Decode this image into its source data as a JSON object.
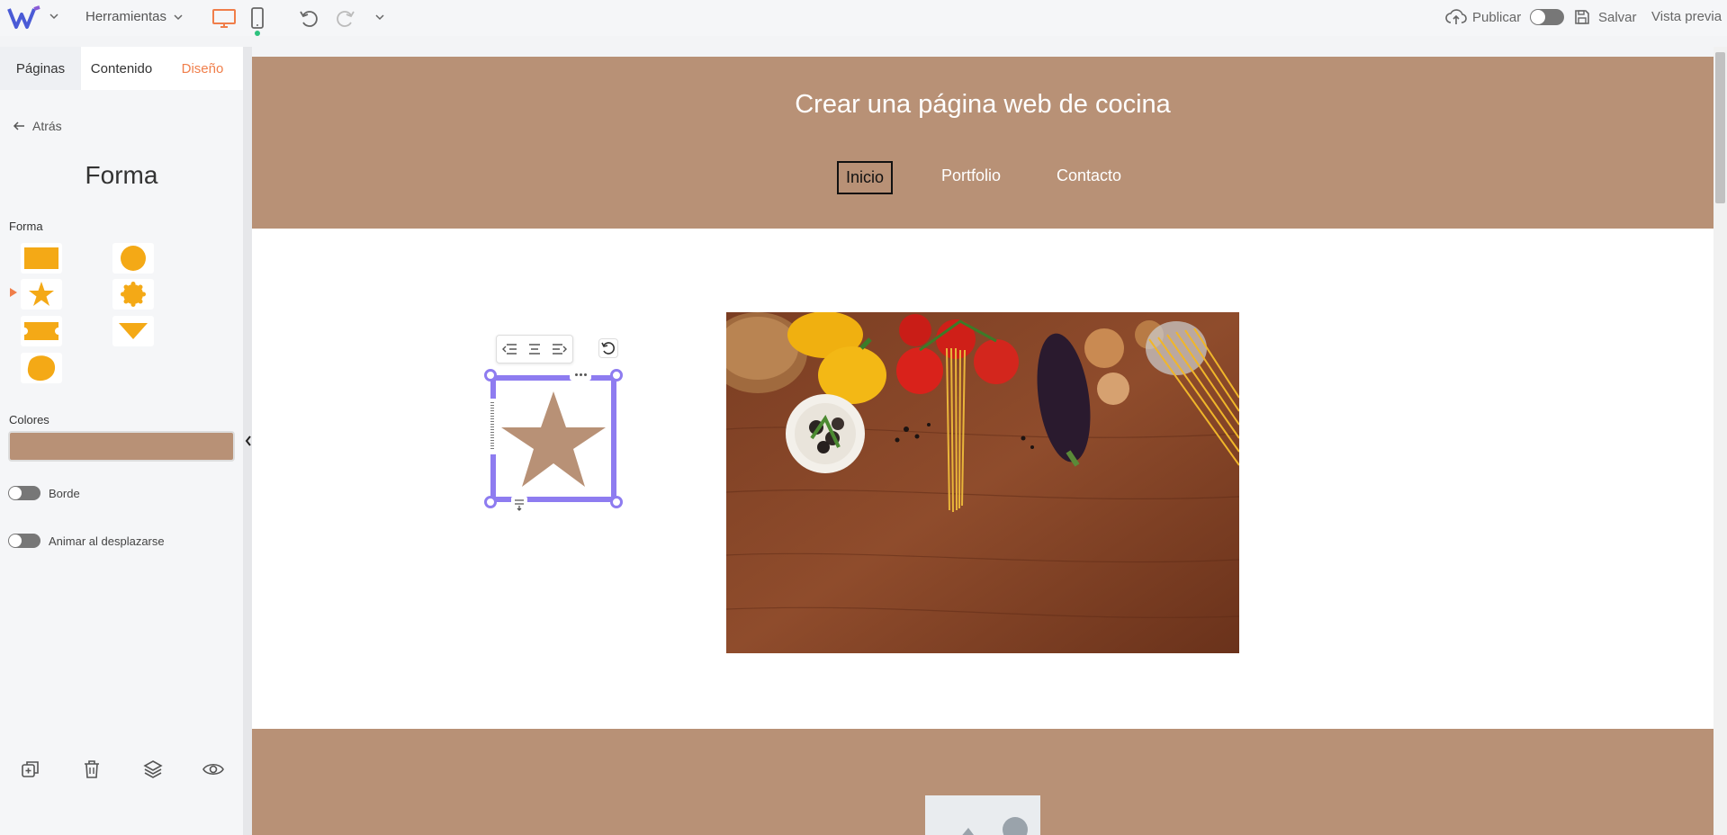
{
  "topbar": {
    "tools_label": "Herramientas",
    "publish_label": "Publicar",
    "save_label": "Salvar",
    "preview_label": "Vista previa"
  },
  "panel": {
    "tabs": [
      {
        "label": "Páginas"
      },
      {
        "label": "Contenido"
      },
      {
        "label": "Diseño"
      }
    ],
    "back_label": "Atrás",
    "title": "Forma",
    "shape_section": "Forma",
    "colors_section": "Colores",
    "color_value": "#b89176",
    "border_label": "Borde",
    "animate_label": "Animar al desplazarse"
  },
  "site": {
    "title": "Crear una página web de cocina",
    "nav": [
      {
        "label": "Inicio"
      },
      {
        "label": "Portfolio"
      },
      {
        "label": "Contacto"
      }
    ]
  },
  "colors": {
    "accent": "#f07e4a",
    "shape_icons": "#f4a916",
    "brand_tan": "#b89176",
    "selection": "#8e7cf0"
  }
}
